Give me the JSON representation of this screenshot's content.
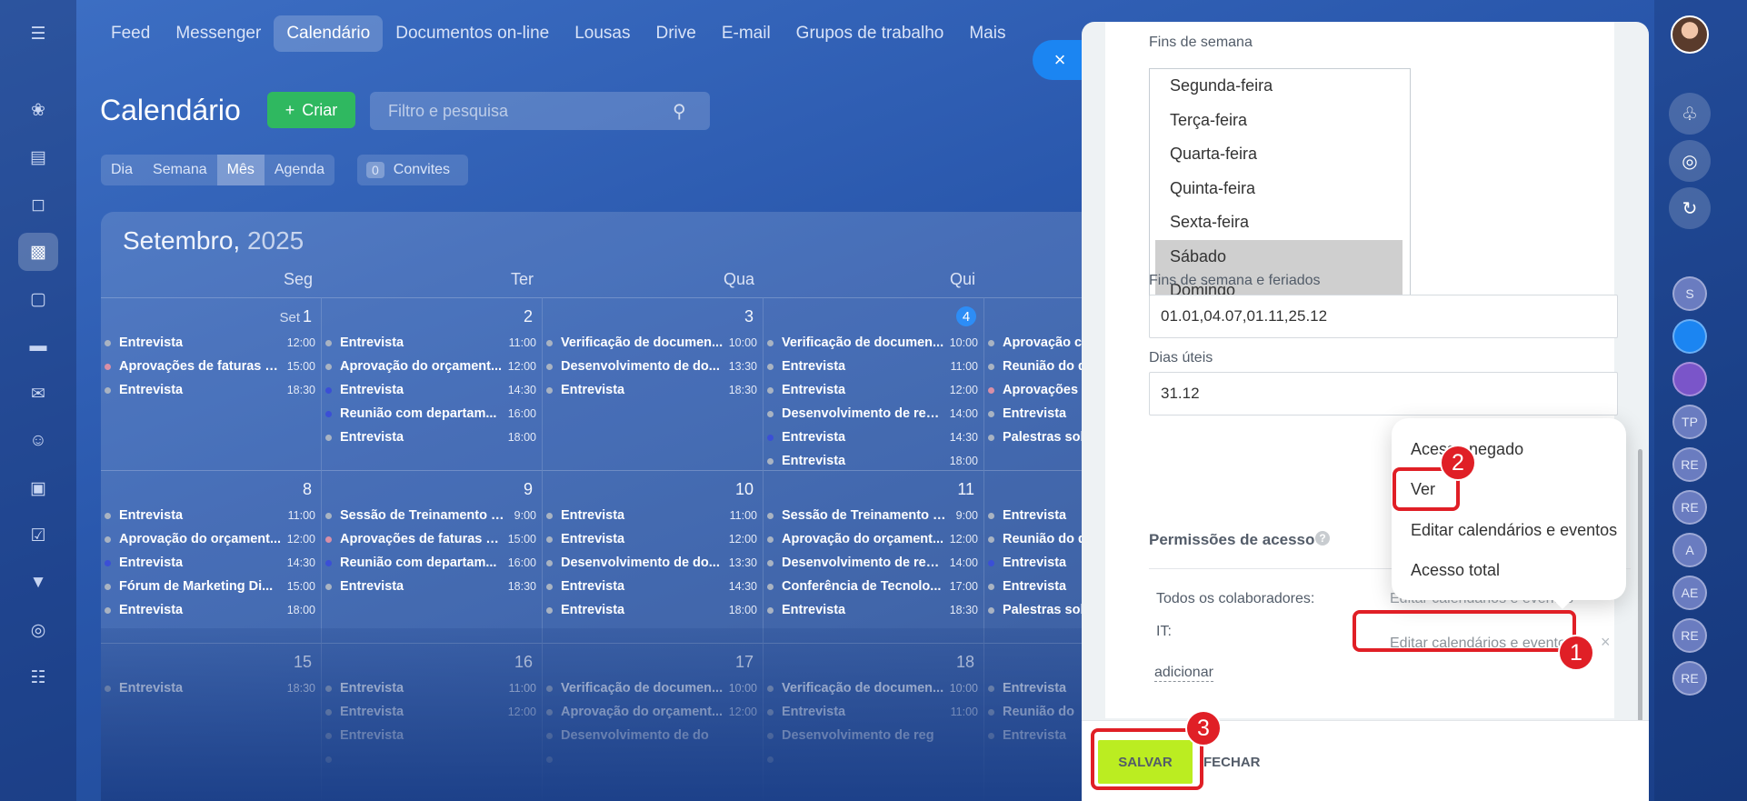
{
  "nav": {
    "items": [
      "Feed",
      "Messenger",
      "Calendário",
      "Documentos on-line",
      "Lousas",
      "Drive",
      "E-mail",
      "Grupos de trabalho",
      "Mais"
    ],
    "active": 2
  },
  "left_icons": [
    "home-icon",
    "document-icon",
    "chat-icon",
    "calendar-icon",
    "file-icon",
    "drive-icon",
    "mail-icon",
    "users-icon",
    "presentation-icon",
    "tasks-icon",
    "funnel-icon",
    "target-icon",
    "cart-icon"
  ],
  "calendar": {
    "title": "Calendário",
    "create_label": "Criar",
    "filter_placeholder": "Filtro e pesquisa",
    "view_tabs": [
      "Dia",
      "Semana",
      "Mês",
      "Agenda"
    ],
    "invites_count": "0",
    "invites_label": "Convites",
    "month": "Setembro,",
    "year": "2025",
    "weekdays": [
      "Seg",
      "Ter",
      "Qua",
      "Qui",
      ""
    ],
    "weeks": [
      [
        {
          "day": "1",
          "month_label": "Set",
          "events": [
            {
              "name": "Entrevista",
              "time": "12:00",
              "color": "#a9b3c2"
            },
            {
              "name": "Aprovações de faturas d...",
              "time": "15:00",
              "color": "#d98fa6"
            },
            {
              "name": "Entrevista",
              "time": "18:30",
              "color": "#a9b3c2"
            }
          ]
        },
        {
          "day": "2",
          "events": [
            {
              "name": "Entrevista",
              "time": "11:00",
              "color": "#a9b3c2"
            },
            {
              "name": "Aprovação do orçament...",
              "time": "12:00",
              "color": "#a9b3c2"
            },
            {
              "name": "Entrevista",
              "time": "14:30",
              "color": "#3b4fd6"
            },
            {
              "name": "Reunião com departam...",
              "time": "16:00",
              "color": "#3b4fd6"
            },
            {
              "name": "Entrevista",
              "time": "18:00",
              "color": "#a9b3c2"
            }
          ]
        },
        {
          "day": "3",
          "events": [
            {
              "name": "Verificação de documen...",
              "time": "10:00",
              "color": "#a9b3c2"
            },
            {
              "name": "Desenvolvimento de do...",
              "time": "13:30",
              "color": "#a9b3c2"
            },
            {
              "name": "Entrevista",
              "time": "18:30",
              "color": "#a9b3c2"
            }
          ]
        },
        {
          "day": "4",
          "today": true,
          "events": [
            {
              "name": "Verificação de documen...",
              "time": "10:00",
              "color": "#a9b3c2"
            },
            {
              "name": "Entrevista",
              "time": "11:00",
              "color": "#a9b3c2"
            },
            {
              "name": "Entrevista",
              "time": "12:00",
              "color": "#a9b3c2"
            },
            {
              "name": "Desenvolvimento de reg...",
              "time": "14:00",
              "color": "#a9b3c2"
            },
            {
              "name": "Entrevista",
              "time": "14:30",
              "color": "#3b4fd6"
            },
            {
              "name": "Entrevista",
              "time": "18:00",
              "color": "#a9b3c2"
            }
          ]
        },
        {
          "day": "",
          "events": [
            {
              "name": "Aprovação c",
              "time": "",
              "color": "#a9b3c2"
            },
            {
              "name": "Reunião do d",
              "time": "",
              "color": "#a9b3c2"
            },
            {
              "name": "Aprovações",
              "time": "",
              "color": "#d98fa6"
            },
            {
              "name": "Entrevista",
              "time": "",
              "color": "#a9b3c2"
            },
            {
              "name": "Palestras sob",
              "time": "",
              "color": "#a9b3c2"
            }
          ]
        }
      ],
      [
        {
          "day": "8",
          "events": [
            {
              "name": "Entrevista",
              "time": "11:00",
              "color": "#a9b3c2"
            },
            {
              "name": "Aprovação do orçament...",
              "time": "12:00",
              "color": "#a9b3c2"
            },
            {
              "name": "Entrevista",
              "time": "14:30",
              "color": "#3b4fd6"
            },
            {
              "name": "Fórum de Marketing Di...",
              "time": "15:00",
              "color": "#a9b3c2"
            },
            {
              "name": "Entrevista",
              "time": "18:00",
              "color": "#a9b3c2"
            }
          ]
        },
        {
          "day": "9",
          "events": [
            {
              "name": "Sessão de Treinamento d...",
              "time": "9:00",
              "color": "#a9b3c2"
            },
            {
              "name": "Aprovações de faturas d...",
              "time": "15:00",
              "color": "#d98fa6"
            },
            {
              "name": "Reunião com departam...",
              "time": "16:00",
              "color": "#3b4fd6"
            },
            {
              "name": "Entrevista",
              "time": "18:30",
              "color": "#a9b3c2"
            }
          ]
        },
        {
          "day": "10",
          "events": [
            {
              "name": "Entrevista",
              "time": "11:00",
              "color": "#a9b3c2"
            },
            {
              "name": "Entrevista",
              "time": "12:00",
              "color": "#a9b3c2"
            },
            {
              "name": "Desenvolvimento de do...",
              "time": "13:30",
              "color": "#a9b3c2"
            },
            {
              "name": "Entrevista",
              "time": "14:30",
              "color": "#a9b3c2"
            },
            {
              "name": "Entrevista",
              "time": "18:00",
              "color": "#a9b3c2"
            }
          ]
        },
        {
          "day": "11",
          "events": [
            {
              "name": "Sessão de Treinamento d...",
              "time": "9:00",
              "color": "#a9b3c2"
            },
            {
              "name": "Aprovação do orçament...",
              "time": "12:00",
              "color": "#a9b3c2"
            },
            {
              "name": "Desenvolvimento de reg...",
              "time": "14:00",
              "color": "#a9b3c2"
            },
            {
              "name": "Conferência de Tecnolo...",
              "time": "17:00",
              "color": "#a9b3c2"
            },
            {
              "name": "Entrevista",
              "time": "18:30",
              "color": "#a9b3c2"
            }
          ]
        },
        {
          "day": "",
          "events": [
            {
              "name": "Entrevista",
              "time": "",
              "color": "#a9b3c2"
            },
            {
              "name": "Reunião do d",
              "time": "",
              "color": "#a9b3c2"
            },
            {
              "name": "Entrevista",
              "time": "",
              "color": "#3b4fd6"
            },
            {
              "name": "Entrevista",
              "time": "",
              "color": "#a9b3c2"
            },
            {
              "name": "Palestras sob",
              "time": "",
              "color": "#a9b3c2"
            }
          ]
        }
      ],
      [
        {
          "day": "15",
          "events": [
            {
              "name": "Entrevista",
              "time": "18:30",
              "color": "#a9b3c2"
            }
          ]
        },
        {
          "day": "16",
          "events": [
            {
              "name": "Entrevista",
              "time": "11:00",
              "color": "#a9b3c2"
            },
            {
              "name": "Entrevista",
              "time": "12:00",
              "color": "#a9b3c2"
            },
            {
              "name": "Entrevista",
              "time": "",
              "color": "#a9b3c2"
            },
            {
              "name": "",
              "time": "",
              "color": "#a9b3c2"
            }
          ]
        },
        {
          "day": "17",
          "events": [
            {
              "name": "Verificação de documen...",
              "time": "10:00",
              "color": "#a9b3c2"
            },
            {
              "name": "Aprovação do orçament...",
              "time": "12:00",
              "color": "#a9b3c2"
            },
            {
              "name": "Desenvolvimento de do",
              "time": "",
              "color": "#a9b3c2"
            },
            {
              "name": "",
              "time": "",
              "color": "#a9b3c2"
            }
          ]
        },
        {
          "day": "18",
          "events": [
            {
              "name": "Verificação de documen...",
              "time": "10:00",
              "color": "#a9b3c2"
            },
            {
              "name": "Entrevista",
              "time": "11:00",
              "color": "#a9b3c2"
            },
            {
              "name": "Desenvolvimento de reg",
              "time": "",
              "color": "#a9b3c2"
            },
            {
              "name": "",
              "time": "",
              "color": "#a9b3c2"
            }
          ]
        },
        {
          "day": "",
          "events": [
            {
              "name": "Entrevista",
              "time": "",
              "color": "#a9b3c2"
            },
            {
              "name": "Reunião do",
              "time": "",
              "color": "#a9b3c2"
            },
            {
              "name": "Entrevista",
              "time": "",
              "color": "#a9b3c2"
            }
          ]
        }
      ]
    ]
  },
  "form": {
    "weekends_label": "Fins de semana",
    "weekend_options": [
      {
        "label": "Segunda-feira",
        "selected": false
      },
      {
        "label": "Terça-feira",
        "selected": false
      },
      {
        "label": "Quarta-feira",
        "selected": false
      },
      {
        "label": "Quinta-feira",
        "selected": false
      },
      {
        "label": "Sexta-feira",
        "selected": false
      },
      {
        "label": "Sábado",
        "selected": true
      },
      {
        "label": "Domingo",
        "selected": true
      }
    ],
    "holidays_label": "Fins de semana e feriados",
    "holidays_value": "01.01,04.07,01.11,25.12",
    "workdays_label": "Dias úteis",
    "workdays_value": "31.12",
    "permissions_title": "Permissões de acesso",
    "help_glyph": "?",
    "perm_rows": [
      {
        "label": "Todos os colaboradores:",
        "value": "Editar calendários e eventos"
      },
      {
        "label": "IT:",
        "value": "Editar calendários e eventos"
      }
    ],
    "add_label": "adicionar",
    "remove_glyph": "×"
  },
  "popup": {
    "items": [
      "Acesso negado",
      "Ver",
      "Editar calendários e eventos",
      "Acesso total"
    ]
  },
  "footer": {
    "save_label": "SALVAR",
    "close_label": "FECHAR"
  },
  "close_glyph": "×",
  "annotations": [
    "1",
    "2",
    "3"
  ],
  "right_icons": [
    "bell-icon",
    "target-icon",
    "refresh-icon"
  ],
  "right_avatars": [
    "S",
    "",
    "",
    "TP",
    "RE",
    "RE",
    "A",
    "AE",
    "RE",
    "RE"
  ],
  "colors": {
    "accent_blue": "#1b85f2",
    "create_green": "#2fb860",
    "save_green": "#bbed21",
    "annotation_red": "#e01f26"
  }
}
